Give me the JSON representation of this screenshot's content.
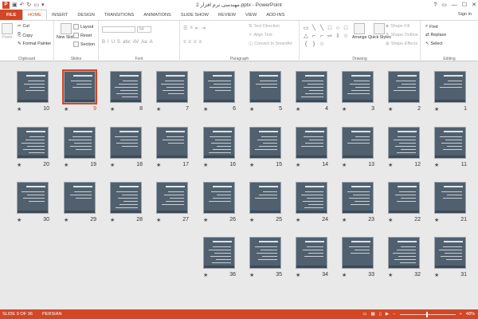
{
  "window": {
    "title": "مهندسی نرم افزار 2.pptx - PowerPoint",
    "controls": [
      "?",
      "▭",
      "—",
      "☐",
      "✕"
    ]
  },
  "ribbon_tabs": [
    "FILE",
    "HOME",
    "INSERT",
    "DESIGN",
    "TRANSITIONS",
    "ANIMATIONS",
    "SLIDE SHOW",
    "REVIEW",
    "VIEW",
    "ADD-INS"
  ],
  "active_tab": "HOME",
  "signin": "Sign in",
  "groups": {
    "clipboard": {
      "label": "Clipboard",
      "paste": "Paste",
      "cut": "Cut",
      "copy": "Copy",
      "format_painter": "Format Painter"
    },
    "slides": {
      "label": "Slides",
      "new_slide": "New Slide",
      "layout": "Layout",
      "reset": "Reset",
      "section": "Section"
    },
    "font": {
      "label": "Font",
      "size": "54",
      "buttons": [
        "B",
        "I",
        "U",
        "S",
        "abc",
        "AV",
        "Aa",
        "A"
      ]
    },
    "paragraph": {
      "label": "Paragraph",
      "text_direction": "Text Direction",
      "align_text": "Align Text",
      "convert_smartart": "Convert to SmartArt"
    },
    "drawing": {
      "label": "Drawing",
      "arrange": "Arrange",
      "quick_styles": "Quick Styles",
      "shape_fill": "Shape Fill",
      "shape_outline": "Shape Outline",
      "shape_effects": "Shape Effects"
    },
    "editing": {
      "label": "Editing",
      "find": "Find",
      "replace": "Replace",
      "select": "Select"
    }
  },
  "slides": [
    {
      "n": "1"
    },
    {
      "n": "2"
    },
    {
      "n": "3"
    },
    {
      "n": "4"
    },
    {
      "n": "5"
    },
    {
      "n": "6"
    },
    {
      "n": "7"
    },
    {
      "n": "8"
    },
    {
      "n": "9"
    },
    {
      "n": "10"
    },
    {
      "n": "11"
    },
    {
      "n": "12"
    },
    {
      "n": "13"
    },
    {
      "n": "14"
    },
    {
      "n": "15"
    },
    {
      "n": "16"
    },
    {
      "n": "17"
    },
    {
      "n": "18"
    },
    {
      "n": "19"
    },
    {
      "n": "20"
    },
    {
      "n": "21"
    },
    {
      "n": "22"
    },
    {
      "n": "23"
    },
    {
      "n": "24"
    },
    {
      "n": "25"
    },
    {
      "n": "26"
    },
    {
      "n": "27"
    },
    {
      "n": "28"
    },
    {
      "n": "29"
    },
    {
      "n": "30"
    },
    {
      "n": "31"
    },
    {
      "n": "32"
    },
    {
      "n": "33"
    },
    {
      "n": "34"
    },
    {
      "n": "35"
    },
    {
      "n": "36"
    }
  ],
  "selected_slide": "9",
  "star_glyph": "★",
  "status": {
    "slide_info": "SLIDE 9 OF 36",
    "language": "PERSIAN",
    "zoom": "48%",
    "zoom_level": 0.48
  },
  "colors": {
    "accent": "#d24726",
    "slide_bg": "#50606e"
  }
}
